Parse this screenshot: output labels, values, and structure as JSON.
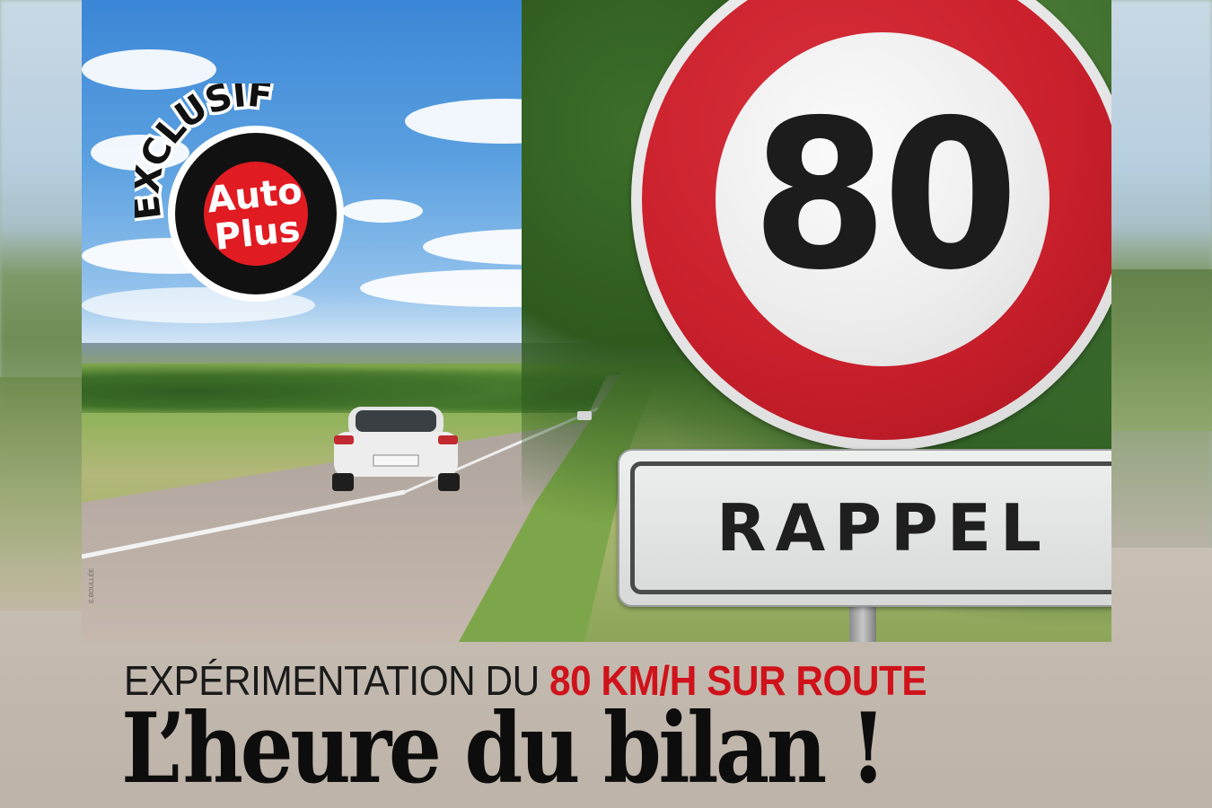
{
  "badge": {
    "top_text": "EXCLUSIF",
    "logo_line1": "Auto",
    "logo_line2": "Plus"
  },
  "sign": {
    "speed_limit": "80",
    "plate_text": "RAPPEL"
  },
  "photo_credit": "E.BOULLÉE",
  "headline": {
    "line1_prefix": "EXPÉRIMENTATION DU ",
    "line1_accent": "80 KM/H SUR ROUTE",
    "line2": "L’heure du bilan !"
  },
  "colors": {
    "accent_red": "#d0121b",
    "sign_red": "#c9202c",
    "text_dark": "#1a1a1a"
  }
}
